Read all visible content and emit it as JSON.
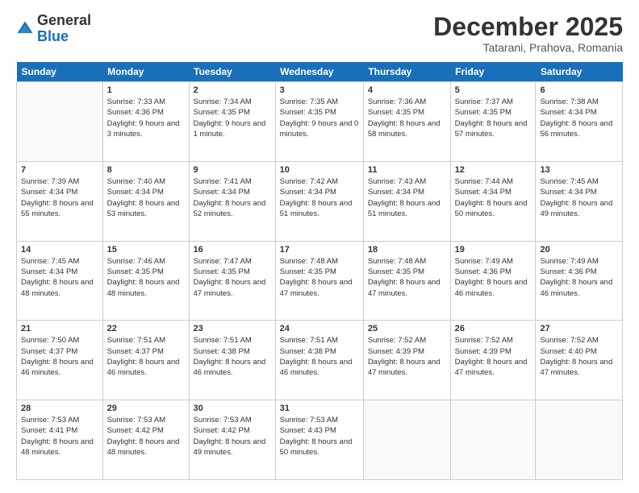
{
  "logo": {
    "general": "General",
    "blue": "Blue"
  },
  "header": {
    "month": "December 2025",
    "location": "Tatarani, Prahova, Romania"
  },
  "weekdays": [
    "Sunday",
    "Monday",
    "Tuesday",
    "Wednesday",
    "Thursday",
    "Friday",
    "Saturday"
  ],
  "weeks": [
    [
      {
        "day": "",
        "sunrise": "",
        "sunset": "",
        "daylight": ""
      },
      {
        "day": "1",
        "sunrise": "Sunrise: 7:33 AM",
        "sunset": "Sunset: 4:36 PM",
        "daylight": "Daylight: 9 hours and 3 minutes."
      },
      {
        "day": "2",
        "sunrise": "Sunrise: 7:34 AM",
        "sunset": "Sunset: 4:35 PM",
        "daylight": "Daylight: 9 hours and 1 minute."
      },
      {
        "day": "3",
        "sunrise": "Sunrise: 7:35 AM",
        "sunset": "Sunset: 4:35 PM",
        "daylight": "Daylight: 9 hours and 0 minutes."
      },
      {
        "day": "4",
        "sunrise": "Sunrise: 7:36 AM",
        "sunset": "Sunset: 4:35 PM",
        "daylight": "Daylight: 8 hours and 58 minutes."
      },
      {
        "day": "5",
        "sunrise": "Sunrise: 7:37 AM",
        "sunset": "Sunset: 4:35 PM",
        "daylight": "Daylight: 8 hours and 57 minutes."
      },
      {
        "day": "6",
        "sunrise": "Sunrise: 7:38 AM",
        "sunset": "Sunset: 4:34 PM",
        "daylight": "Daylight: 8 hours and 56 minutes."
      }
    ],
    [
      {
        "day": "7",
        "sunrise": "Sunrise: 7:39 AM",
        "sunset": "Sunset: 4:34 PM",
        "daylight": "Daylight: 8 hours and 55 minutes."
      },
      {
        "day": "8",
        "sunrise": "Sunrise: 7:40 AM",
        "sunset": "Sunset: 4:34 PM",
        "daylight": "Daylight: 8 hours and 53 minutes."
      },
      {
        "day": "9",
        "sunrise": "Sunrise: 7:41 AM",
        "sunset": "Sunset: 4:34 PM",
        "daylight": "Daylight: 8 hours and 52 minutes."
      },
      {
        "day": "10",
        "sunrise": "Sunrise: 7:42 AM",
        "sunset": "Sunset: 4:34 PM",
        "daylight": "Daylight: 8 hours and 51 minutes."
      },
      {
        "day": "11",
        "sunrise": "Sunrise: 7:43 AM",
        "sunset": "Sunset: 4:34 PM",
        "daylight": "Daylight: 8 hours and 51 minutes."
      },
      {
        "day": "12",
        "sunrise": "Sunrise: 7:44 AM",
        "sunset": "Sunset: 4:34 PM",
        "daylight": "Daylight: 8 hours and 50 minutes."
      },
      {
        "day": "13",
        "sunrise": "Sunrise: 7:45 AM",
        "sunset": "Sunset: 4:34 PM",
        "daylight": "Daylight: 8 hours and 49 minutes."
      }
    ],
    [
      {
        "day": "14",
        "sunrise": "Sunrise: 7:45 AM",
        "sunset": "Sunset: 4:34 PM",
        "daylight": "Daylight: 8 hours and 48 minutes."
      },
      {
        "day": "15",
        "sunrise": "Sunrise: 7:46 AM",
        "sunset": "Sunset: 4:35 PM",
        "daylight": "Daylight: 8 hours and 48 minutes."
      },
      {
        "day": "16",
        "sunrise": "Sunrise: 7:47 AM",
        "sunset": "Sunset: 4:35 PM",
        "daylight": "Daylight: 8 hours and 47 minutes."
      },
      {
        "day": "17",
        "sunrise": "Sunrise: 7:48 AM",
        "sunset": "Sunset: 4:35 PM",
        "daylight": "Daylight: 8 hours and 47 minutes."
      },
      {
        "day": "18",
        "sunrise": "Sunrise: 7:48 AM",
        "sunset": "Sunset: 4:35 PM",
        "daylight": "Daylight: 8 hours and 47 minutes."
      },
      {
        "day": "19",
        "sunrise": "Sunrise: 7:49 AM",
        "sunset": "Sunset: 4:36 PM",
        "daylight": "Daylight: 8 hours and 46 minutes."
      },
      {
        "day": "20",
        "sunrise": "Sunrise: 7:49 AM",
        "sunset": "Sunset: 4:36 PM",
        "daylight": "Daylight: 8 hours and 46 minutes."
      }
    ],
    [
      {
        "day": "21",
        "sunrise": "Sunrise: 7:50 AM",
        "sunset": "Sunset: 4:37 PM",
        "daylight": "Daylight: 8 hours and 46 minutes."
      },
      {
        "day": "22",
        "sunrise": "Sunrise: 7:51 AM",
        "sunset": "Sunset: 4:37 PM",
        "daylight": "Daylight: 8 hours and 46 minutes."
      },
      {
        "day": "23",
        "sunrise": "Sunrise: 7:51 AM",
        "sunset": "Sunset: 4:38 PM",
        "daylight": "Daylight: 8 hours and 46 minutes."
      },
      {
        "day": "24",
        "sunrise": "Sunrise: 7:51 AM",
        "sunset": "Sunset: 4:38 PM",
        "daylight": "Daylight: 8 hours and 46 minutes."
      },
      {
        "day": "25",
        "sunrise": "Sunrise: 7:52 AM",
        "sunset": "Sunset: 4:39 PM",
        "daylight": "Daylight: 8 hours and 47 minutes."
      },
      {
        "day": "26",
        "sunrise": "Sunrise: 7:52 AM",
        "sunset": "Sunset: 4:39 PM",
        "daylight": "Daylight: 8 hours and 47 minutes."
      },
      {
        "day": "27",
        "sunrise": "Sunrise: 7:52 AM",
        "sunset": "Sunset: 4:40 PM",
        "daylight": "Daylight: 8 hours and 47 minutes."
      }
    ],
    [
      {
        "day": "28",
        "sunrise": "Sunrise: 7:53 AM",
        "sunset": "Sunset: 4:41 PM",
        "daylight": "Daylight: 8 hours and 48 minutes."
      },
      {
        "day": "29",
        "sunrise": "Sunrise: 7:53 AM",
        "sunset": "Sunset: 4:42 PM",
        "daylight": "Daylight: 8 hours and 48 minutes."
      },
      {
        "day": "30",
        "sunrise": "Sunrise: 7:53 AM",
        "sunset": "Sunset: 4:42 PM",
        "daylight": "Daylight: 8 hours and 49 minutes."
      },
      {
        "day": "31",
        "sunrise": "Sunrise: 7:53 AM",
        "sunset": "Sunset: 4:43 PM",
        "daylight": "Daylight: 8 hours and 50 minutes."
      },
      {
        "day": "",
        "sunrise": "",
        "sunset": "",
        "daylight": ""
      },
      {
        "day": "",
        "sunrise": "",
        "sunset": "",
        "daylight": ""
      },
      {
        "day": "",
        "sunrise": "",
        "sunset": "",
        "daylight": ""
      }
    ]
  ]
}
